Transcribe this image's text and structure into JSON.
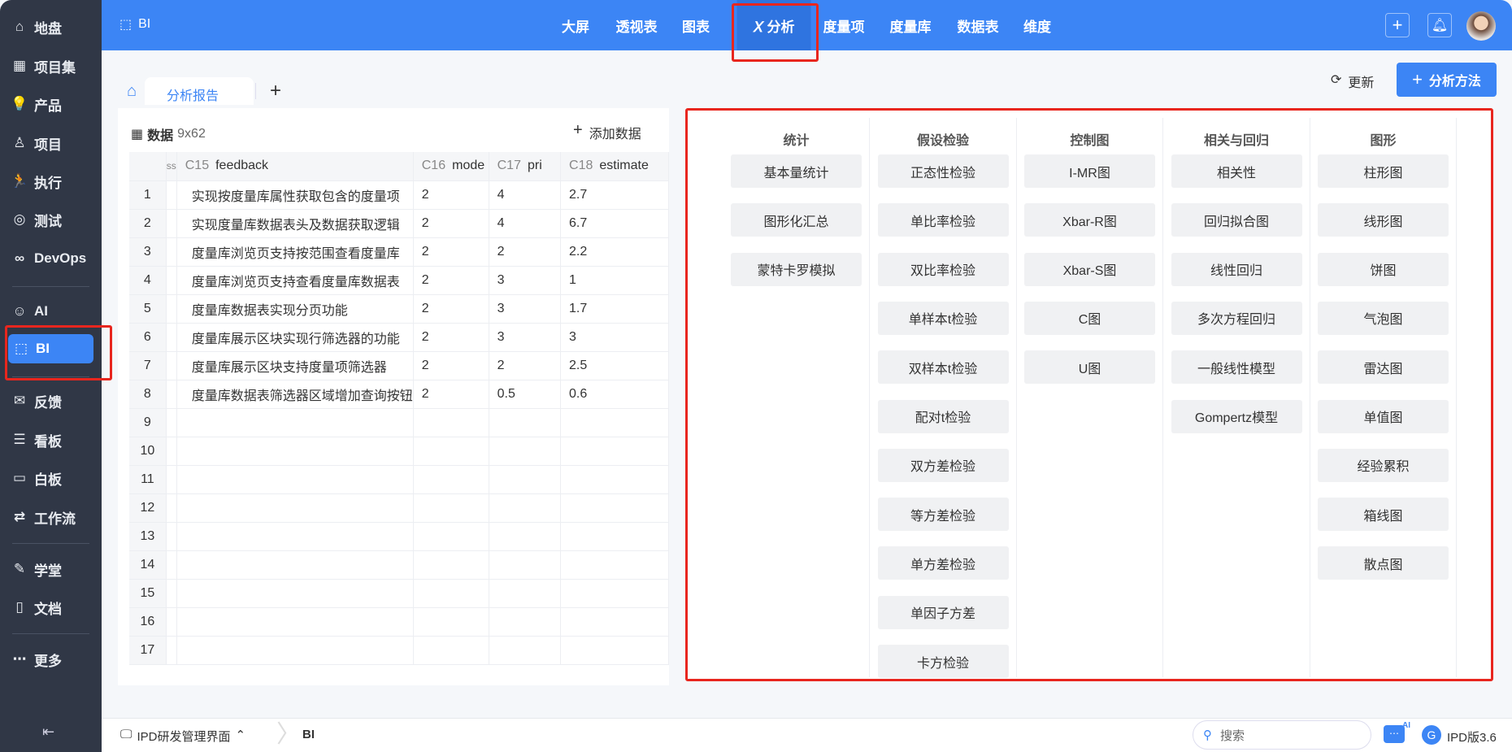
{
  "sidebar": {
    "items": [
      {
        "label": "地盘",
        "icon": "home-icon",
        "g": "⌂"
      },
      {
        "label": "项目集",
        "icon": "grid-icon",
        "g": "▦"
      },
      {
        "label": "产品",
        "icon": "lightbulb-icon",
        "g": "💡"
      },
      {
        "label": "项目",
        "icon": "rocket-icon",
        "g": "♙"
      },
      {
        "label": "执行",
        "icon": "run-icon",
        "g": "🏃"
      },
      {
        "label": "测试",
        "icon": "search-icon",
        "g": "◎"
      },
      {
        "label": "DevOps",
        "icon": "infinity-icon",
        "g": "∞"
      },
      {
        "label": "AI",
        "icon": "robot-icon",
        "g": "☺"
      },
      {
        "label": "BI",
        "icon": "chart-board-icon",
        "g": "⬚"
      },
      {
        "label": "反馈",
        "icon": "feedback-icon",
        "g": "✉"
      },
      {
        "label": "看板",
        "icon": "kanban-icon",
        "g": "☰"
      },
      {
        "label": "白板",
        "icon": "whiteboard-icon",
        "g": "▭"
      },
      {
        "label": "工作流",
        "icon": "workflow-icon",
        "g": "⇄"
      },
      {
        "label": "学堂",
        "icon": "school-icon",
        "g": "✎"
      },
      {
        "label": "文档",
        "icon": "doc-icon",
        "g": "▯"
      },
      {
        "label": "更多",
        "icon": "more-icon",
        "g": "⋯"
      }
    ],
    "collapse_icon": "collapse-left-icon"
  },
  "topbar": {
    "app_title": "BI",
    "nav": [
      "大屏",
      "透视表",
      "图表",
      "𝑋 分析",
      "度量项",
      "度量库",
      "数据表",
      "维度"
    ],
    "active_nav": 3
  },
  "tabs": {
    "active": "分析报告",
    "add": "+"
  },
  "actions": {
    "refresh": "更新",
    "add_method": "分析方法"
  },
  "data_panel": {
    "title": "数据",
    "dims": "9x62",
    "add_data": "添加数据",
    "columns": [
      {
        "id": "C15",
        "name": "feedback"
      },
      {
        "id": "C16",
        "name": "mode"
      },
      {
        "id": "C17",
        "name": "pri"
      },
      {
        "id": "C18",
        "name": "estimate"
      }
    ],
    "frozen_header": "ss",
    "rows": [
      [
        "实现按度量库属性获取包含的度量项",
        "2",
        "4",
        "2.7"
      ],
      [
        "实现度量库数据表头及数据获取逻辑",
        "2",
        "4",
        "6.7"
      ],
      [
        "度量库浏览页支持按范围查看度量库",
        "2",
        "2",
        "2.2"
      ],
      [
        "度量库浏览页支持查看度量库数据表",
        "2",
        "3",
        "1"
      ],
      [
        "度量库数据表实现分页功能",
        "2",
        "3",
        "1.7"
      ],
      [
        "度量库展示区块实现行筛选器的功能",
        "2",
        "3",
        "3"
      ],
      [
        "度量库展示区块支持度量项筛选器",
        "2",
        "2",
        "2.5"
      ],
      [
        "度量库数据表筛选器区域增加查询按钮",
        "2",
        "0.5",
        "0.6"
      ],
      [
        "",
        "",
        "",
        ""
      ],
      [
        "",
        "",
        "",
        ""
      ],
      [
        "",
        "",
        "",
        ""
      ],
      [
        "",
        "",
        "",
        ""
      ],
      [
        "",
        "",
        "",
        ""
      ],
      [
        "",
        "",
        "",
        ""
      ],
      [
        "",
        "",
        "",
        ""
      ],
      [
        "",
        "",
        "",
        ""
      ],
      [
        "",
        "",
        "",
        ""
      ]
    ]
  },
  "methods": [
    {
      "title": "统计",
      "items": [
        "基本量统计",
        "图形化汇总",
        "蒙特卡罗模拟"
      ]
    },
    {
      "title": "假设检验",
      "items": [
        "正态性检验",
        "单比率检验",
        "双比率检验",
        "单样本t检验",
        "双样本t检验",
        "配对t检验",
        "双方差检验",
        "等方差检验",
        "单方差检验",
        "单因子方差",
        "卡方检验"
      ]
    },
    {
      "title": "控制图",
      "items": [
        "I-MR图",
        "Xbar-R图",
        "Xbar-S图",
        "C图",
        "U图"
      ]
    },
    {
      "title": "相关与回归",
      "items": [
        "相关性",
        "回归拟合图",
        "线性回归",
        "多次方程回归",
        "一般线性模型",
        "Gompertz模型"
      ]
    },
    {
      "title": "图形",
      "items": [
        "柱形图",
        "线形图",
        "饼图",
        "气泡图",
        "雷达图",
        "单值图",
        "经验累积",
        "箱线图",
        "散点图"
      ]
    }
  ],
  "bottombar": {
    "workspace": "IPD研发管理界面",
    "crumb": "BI",
    "search_placeholder": "搜索",
    "version": "IPD版3.6",
    "ai_badge": "AI"
  },
  "colors": {
    "primary": "#3c85f5",
    "sidebar": "#303746",
    "annotation": "#e8261e"
  }
}
